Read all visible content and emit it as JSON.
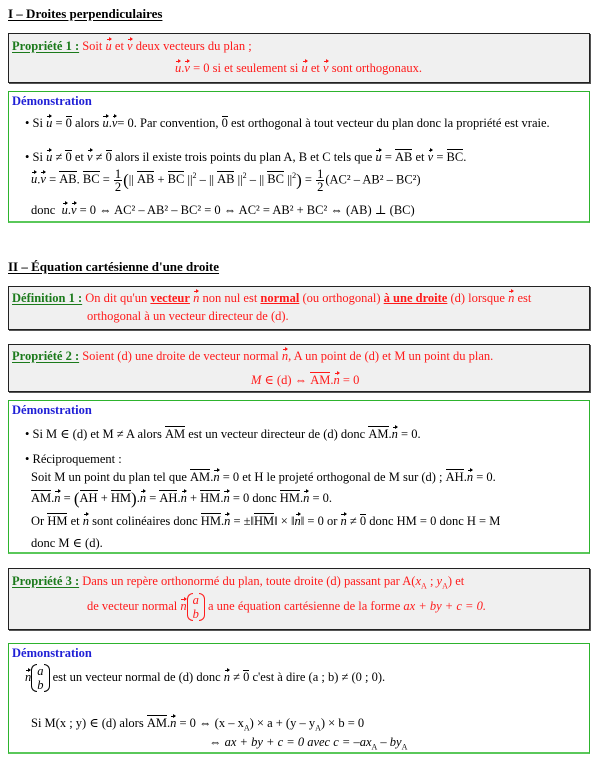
{
  "section1": {
    "heading": "I – Droites perpendiculaires",
    "prop1": {
      "label": "Propriété 1 :",
      "line1_a": "Soit",
      "line1_b": "et",
      "line1_c": "deux vecteurs du plan ;",
      "line2_a": "= 0 si et seulement si",
      "line2_b": "et",
      "line2_c": "sont orthogonaux."
    },
    "demo1": {
      "title": "Démonstration",
      "b1_a": "• Si",
      "b1_b": "alors",
      "b1_c": "= 0. Par convention,",
      "b1_d": "est orthogonal à tout vecteur du plan donc la propriété est vraie.",
      "b2_a": "• Si",
      "b2_b": "et",
      "b2_c": "alors il existe trois points du plan A, B et C tels que",
      "b2_d": "et",
      "eq1_rhs": "(AC² – AB² – BC²)",
      "eq2_prefix": "donc",
      "eq2_rest": "= 0 ⇔ AC² – AB² – BC² = 0 ⇔ AC² = AB² + BC² ⇔ (AB) ⊥ (BC)"
    }
  },
  "section2": {
    "heading": "II – Équation cartésienne d'une droite",
    "def1": {
      "label": "Définition 1 :",
      "t1": "On dit qu'un",
      "u1": "vecteur",
      "t2": "non nul est",
      "u2": "normal",
      "t3": "(ou orthogonal)",
      "u3": "à une droite",
      "t4": "(d) lorsque",
      "t5": "est",
      "line2": "orthogonal à un vecteur directeur de (d)."
    },
    "prop2": {
      "label": "Propriété 2 :",
      "line1_a": "Soient (d) une droite de vecteur normal",
      "line1_b": ", A un point de (d) et M un point du plan.",
      "line2_a": "∈ (d) ⇔",
      "line2_b": "= 0"
    },
    "demo2": {
      "title": "Démonstration",
      "b1_a": "• Si M ∈ (d) et M ≠ A alors",
      "b1_b": "est un vecteur directeur de (d) donc",
      "b1_c": "= 0.",
      "b2": "• Réciproquement :",
      "l3_a": "Soit M un point du plan tel que",
      "l3_b": "= 0 et H le projeté orthogonal de M sur (d) ;",
      "l3_c": "= 0.",
      "l4_a": "=",
      "l4_b": "= 0 donc",
      "l4_c": "= 0.",
      "l5_a": "Or",
      "l5_b": "et",
      "l5_c": "sont colinéaires donc",
      "l5_d": "= ±",
      "l5_e": "= 0 or",
      "l5_f": "donc HM = 0 donc H = M",
      "l6": "donc M ∈ (d)."
    },
    "prop3": {
      "label": "Propriété 3 :",
      "line1": "Dans un repère orthonormé du plan, toute droite (d) passant par",
      "line1_end": "et",
      "line2_a": "de vecteur normal",
      "line2_b": "a une équation cartésienne de la forme",
      "eq": "ax + by + c = 0."
    },
    "demo3": {
      "title": "Démonstration",
      "l1_a": "est un vecteur normal de (d) donc",
      "l1_b": "c'est à dire",
      "l1_c": "(a ; b) ≠ (0 ; 0).",
      "l2_a": "Si M(x ; y) ∈ (d) alors",
      "l2_b": "= 0 ⇔ (x – x",
      "l2_c": ") × a + (y – y",
      "l2_d": ") × b = 0",
      "l3_a": "⇔ ax + by + c = 0  avec  c = –ax",
      "l3_b": " – by"
    }
  }
}
